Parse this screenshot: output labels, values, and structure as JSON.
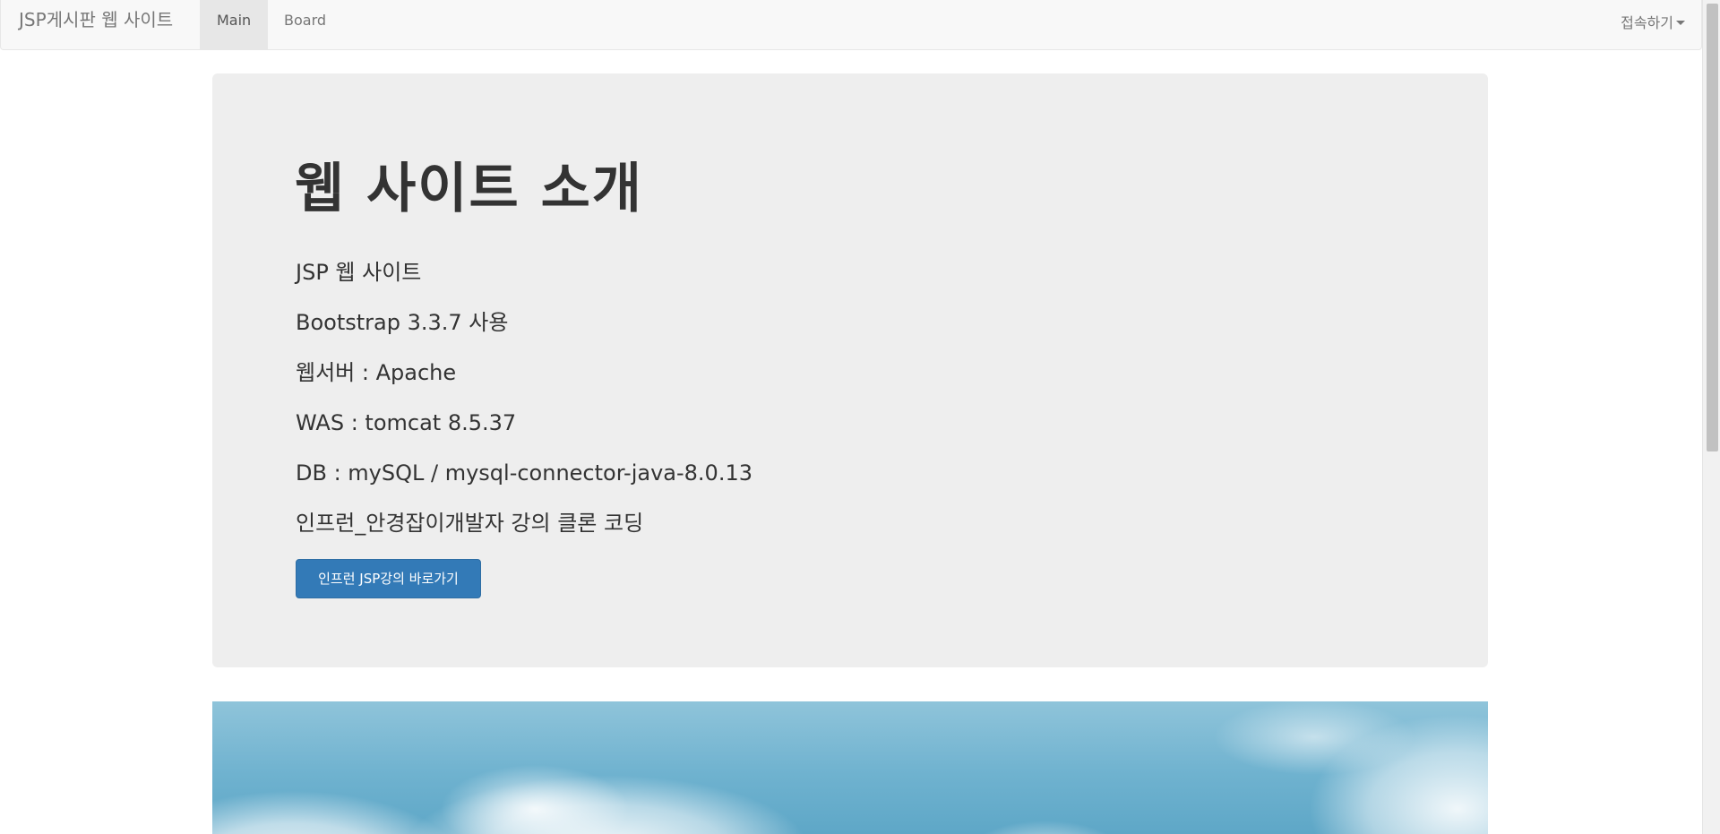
{
  "navbar": {
    "brand": "JSP게시판 웹 사이트",
    "items": [
      {
        "label": "Main",
        "active": true
      },
      {
        "label": "Board",
        "active": false
      }
    ],
    "dropdown_label": "접속하기"
  },
  "jumbotron": {
    "title": "웹 사이트 소개",
    "lines": [
      "JSP 웹 사이트",
      "Bootstrap 3.3.7 사용",
      "웹서버 : Apache",
      "WAS : tomcat 8.5.37",
      "DB : mySQL / mysql-connector-java-8.0.13",
      "인프런_안경잡이개발자 강의 클론 코딩"
    ],
    "button_label": "인프런 JSP강의 바로가기"
  },
  "colors": {
    "primary": "#337ab7",
    "jumbotron_bg": "#eeeeee",
    "navbar_bg": "#f8f8f8"
  }
}
